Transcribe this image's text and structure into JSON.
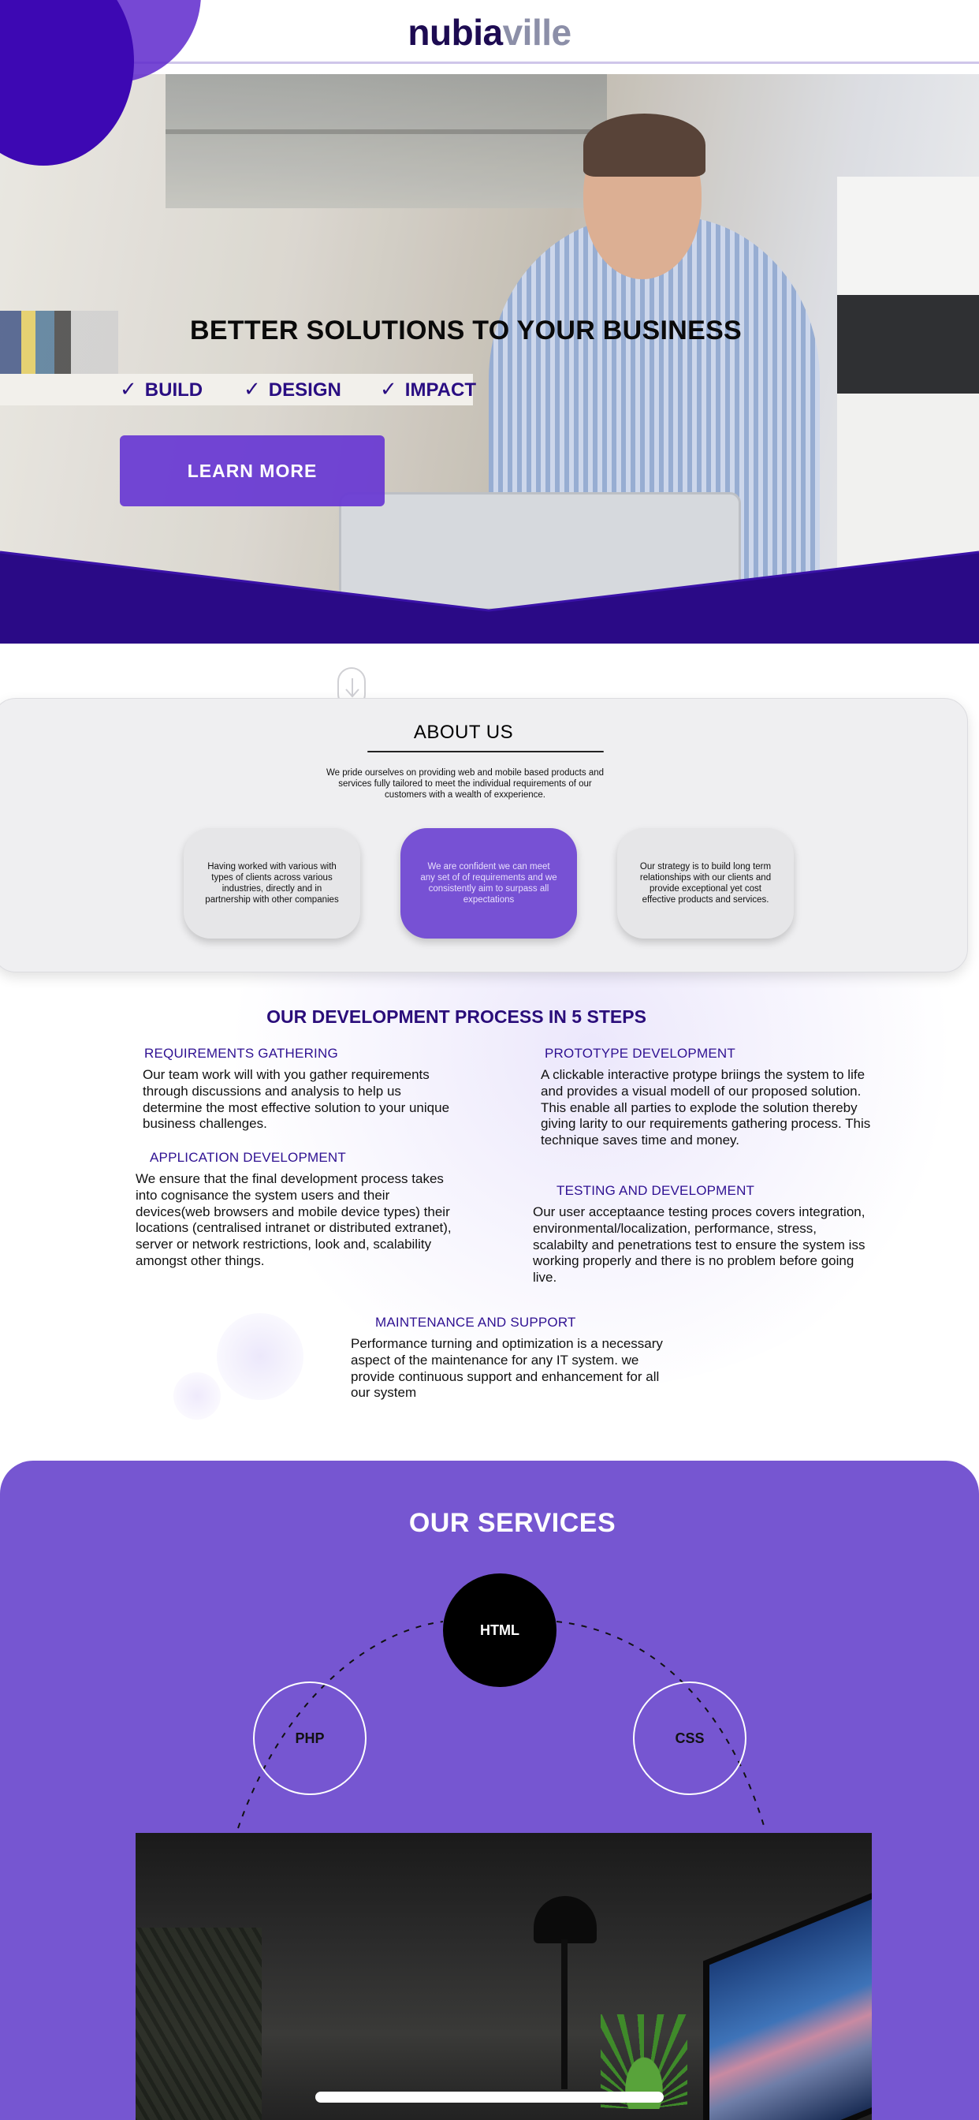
{
  "brand": {
    "part1": "nubia",
    "part2": "ville",
    "color_primary": "#1d0b52",
    "color_secondary": "#8c8fa8"
  },
  "hero": {
    "title": "BETTER SOLUTIONS TO YOUR BUSINESS",
    "checks": [
      {
        "icon": "checkmark-icon",
        "label": "BUILD"
      },
      {
        "icon": "checkmark-icon",
        "label": "DESIGN"
      },
      {
        "icon": "checkmark-icon",
        "label": "IMPACT"
      }
    ],
    "cta_label": "LEARN  MORE",
    "accent": "#3d08b3"
  },
  "about": {
    "title": "ABOUT US",
    "text": "We pride ourselves on providing web and mobile based products and services fully tailored to meet the individual requirements of our customers with a wealth of exxperience.",
    "cards": [
      {
        "text": "Having worked with various with types of clients across various industries, directly and in partnership with other companies",
        "style": "grey"
      },
      {
        "text": "We are confident we can meet any set of of requirements and we consistently aim to surpass all expectations",
        "style": "purple"
      },
      {
        "text": "Our strategy is to build long term relationships with our clients and provide exceptional yet cost effective products and services.",
        "style": "grey"
      }
    ]
  },
  "process": {
    "title": "OUR DEVELOPMENT PROCESS IN 5 STEPS",
    "steps": [
      {
        "heading": "REQUIREMENTS GATHERING",
        "text": "Our team work will with you gather requirements through discussions and analysis to help us determine the most effective solution to your unique business challenges."
      },
      {
        "heading": "PROTOTYPE DEVELOPMENT",
        "text": "A clickable interactive protype briings the system to life and provides a visual modell of our proposed solution. This enable all parties to explode the solution thereby giving larity to our requirements gathering process. This technique saves time and money."
      },
      {
        "heading": "APPLICATION DEVELOPMENT",
        "text": "We ensure that the final development process takes into cognisance the system users and their devices(web browsers and mobile device types) their locations (centralised intranet or distributed extranet), server or network restrictions,  look and, scalability amongst other things."
      },
      {
        "heading": "TESTING AND DEVELOPMENT",
        "text": "Our user acceptaance testing proces covers integration, environmental/localization, performance, stress, scalabilty and penetrations test to ensure the system iss working properly and there is no problem before going live."
      },
      {
        "heading": "MAINTENANCE AND SUPPORT",
        "text": "Performance turning and optimization is a necessary aspect of the maintenance for any IT system. we provide continuous support and enhancement for all our system"
      }
    ]
  },
  "services": {
    "title": "OUR SERVICES",
    "items": [
      "HTML",
      "PHP",
      "CSS"
    ],
    "background": "#7656d1"
  }
}
